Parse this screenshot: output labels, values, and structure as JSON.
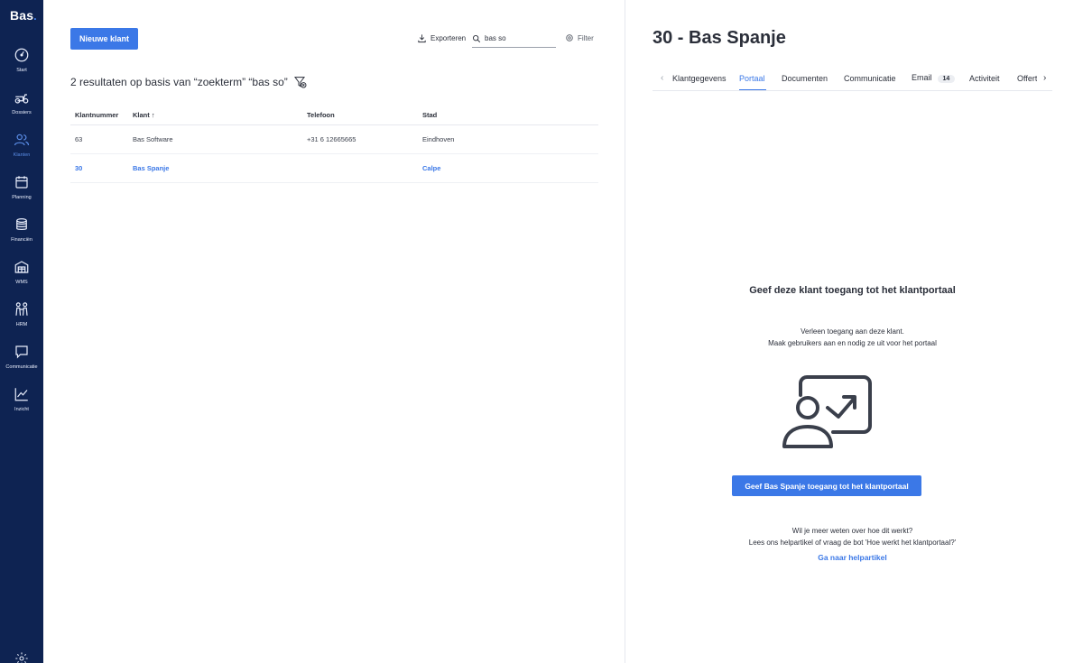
{
  "sidebar": {
    "logo": "Bas",
    "items": [
      {
        "label": "Start",
        "icon": "gauge-icon"
      },
      {
        "label": "Dossiers",
        "icon": "scooter-icon"
      },
      {
        "label": "Klanten",
        "icon": "users-icon",
        "active": true
      },
      {
        "label": "Planning",
        "icon": "calendar-icon"
      },
      {
        "label": "Financiën",
        "icon": "coins-icon"
      },
      {
        "label": "WMS",
        "icon": "warehouse-icon"
      },
      {
        "label": "HRM",
        "icon": "people-icon"
      },
      {
        "label": "Communicatie",
        "icon": "chat-icon"
      },
      {
        "label": "Inzicht",
        "icon": "chart-icon"
      }
    ]
  },
  "toolbar": {
    "new_client_label": "Nieuwe klant",
    "export_label": "Exporteren",
    "search_value": "bas so",
    "filter_label": "Filter"
  },
  "results_text": "2 resultaten op basis van “zoekterm” “bas so”",
  "table": {
    "headers": [
      "Klantnummer",
      "Klant",
      "Telefoon",
      "Stad"
    ],
    "rows": [
      {
        "number": "63",
        "client": "Bas Software",
        "phone": "+31 6 12665665",
        "city": "Eindhoven"
      },
      {
        "number": "30",
        "client": "Bas Spanje",
        "phone": "",
        "city": "Calpe",
        "selected": true
      }
    ]
  },
  "detail": {
    "title": "30 - Bas Spanje",
    "tabs": {
      "klantgegevens": "Klantgegevens",
      "portaal": "Portaal",
      "documenten": "Documenten",
      "communicatie": "Communicatie",
      "email": "Email",
      "email_count": "14",
      "activiteit": "Activiteit",
      "offertes": "Offertes"
    },
    "portal": {
      "heading": "Geef deze klant toegang tot het klantportaal",
      "desc_line1": "Verleen toegang aan deze klant.",
      "desc_line2": "Maak gebruikers aan en nodig ze uit voor het portaal",
      "button": "Geef Bas Spanje toegang tot het klantportaal",
      "help_line1": "Wil je meer weten over hoe dit werkt?",
      "help_line2": "Lees ons helpartikel of vraag de bot 'Hoe werkt het klantportaal?'",
      "help_link": "Ga naar helpartikel"
    }
  },
  "colors": {
    "sidebar_bg": "#0e2352",
    "accent": "#3b78e7"
  }
}
